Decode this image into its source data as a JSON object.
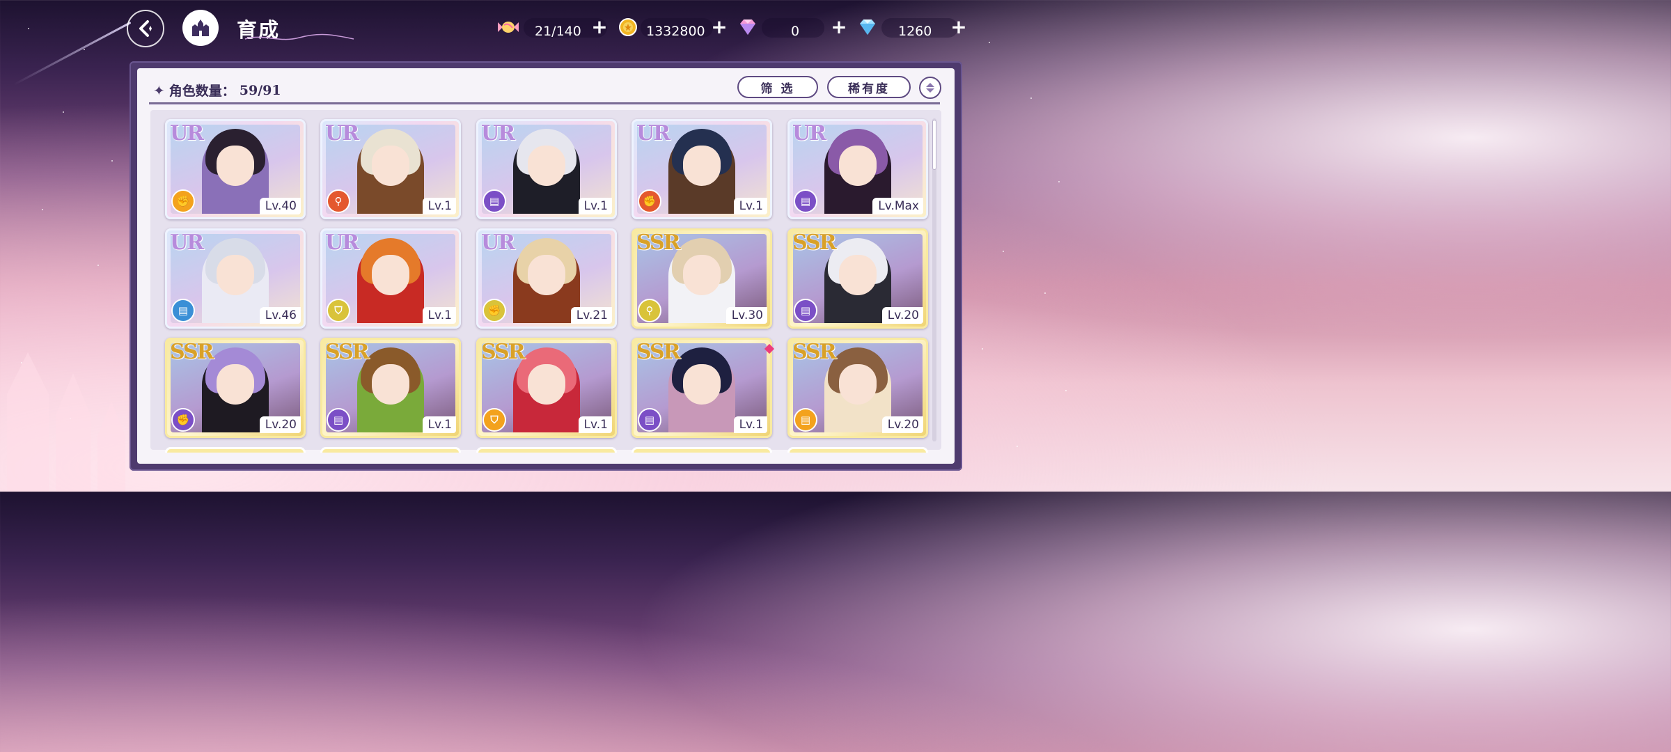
{
  "header": {
    "title": "育成",
    "back_icon": "back-arrow-icon",
    "home_icon": "castle-icon"
  },
  "resources": [
    {
      "name": "stamina",
      "icon": "candy-icon",
      "value": "21/140"
    },
    {
      "name": "gold",
      "icon": "coin-icon",
      "value": "1332800"
    },
    {
      "name": "paid_gem",
      "icon": "pink-diamond-icon",
      "value": "0"
    },
    {
      "name": "free_gem",
      "icon": "blue-diamond-icon",
      "value": "1260"
    }
  ],
  "panel": {
    "count_label": "角色数量：",
    "count_value": "59/91",
    "filter_label": "筛 选",
    "sort_label": "稀有度"
  },
  "colors": {
    "accent": "#4e3a6e",
    "type_orange": "#f3a21d",
    "type_red": "#e4582e",
    "type_purple": "#7b4fc6",
    "type_blue": "#3a8fd6",
    "type_yellow": "#d9c33a",
    "new_marker": "#ec3c7c"
  },
  "cards": [
    {
      "rarity": "UR",
      "level": "Lv.40",
      "type": "fist",
      "type_color": "#f3a21d",
      "palette": [
        "#2a2030",
        "#8a70b8"
      ]
    },
    {
      "rarity": "UR",
      "level": "Lv.1",
      "type": "wand",
      "type_color": "#e4582e",
      "palette": [
        "#e9e2d2",
        "#7a4a2a"
      ]
    },
    {
      "rarity": "UR",
      "level": "Lv.1",
      "type": "book",
      "type_color": "#7b4fc6",
      "palette": [
        "#e6e6ee",
        "#1e1e28"
      ]
    },
    {
      "rarity": "UR",
      "level": "Lv.1",
      "type": "fist",
      "type_color": "#e4582e",
      "palette": [
        "#243050",
        "#5a3a28"
      ]
    },
    {
      "rarity": "UR",
      "level": "Lv.Max",
      "type": "book",
      "type_color": "#7b4fc6",
      "palette": [
        "#8a5aa8",
        "#2a1a2e"
      ]
    },
    {
      "rarity": "UR",
      "level": "Lv.46",
      "type": "book",
      "type_color": "#3a8fd6",
      "palette": [
        "#d8dce8",
        "#eaeaf4"
      ]
    },
    {
      "rarity": "UR",
      "level": "Lv.1",
      "type": "shield",
      "type_color": "#d9c33a",
      "palette": [
        "#e57a2a",
        "#c82a24"
      ]
    },
    {
      "rarity": "UR",
      "level": "Lv.21",
      "type": "fist",
      "type_color": "#d9c33a",
      "palette": [
        "#e8d2a8",
        "#8a3a1e"
      ]
    },
    {
      "rarity": "SSR",
      "level": "Lv.30",
      "type": "wand",
      "type_color": "#d9c33a",
      "palette": [
        "#e2cfb0",
        "#f2f2f6"
      ]
    },
    {
      "rarity": "SSR",
      "level": "Lv.20",
      "type": "book",
      "type_color": "#7b4fc6",
      "palette": [
        "#ececf2",
        "#2a2a34"
      ]
    },
    {
      "rarity": "SSR",
      "level": "Lv.20",
      "type": "fist",
      "type_color": "#7b4fc6",
      "palette": [
        "#a48ad6",
        "#1e1a22"
      ]
    },
    {
      "rarity": "SSR",
      "level": "Lv.1",
      "type": "book",
      "type_color": "#7b4fc6",
      "palette": [
        "#8a5a2a",
        "#7aaa3a"
      ]
    },
    {
      "rarity": "SSR",
      "level": "Lv.1",
      "type": "shield",
      "type_color": "#f3a21d",
      "palette": [
        "#ea6a78",
        "#c8283a"
      ]
    },
    {
      "rarity": "SSR",
      "level": "Lv.1",
      "type": "book",
      "type_color": "#7b4fc6",
      "palette": [
        "#1e2040",
        "#c898b8"
      ],
      "new": true
    },
    {
      "rarity": "SSR",
      "level": "Lv.20",
      "type": "book",
      "type_color": "#f3a21d",
      "palette": [
        "#8a6040",
        "#f2e2c8"
      ]
    }
  ]
}
